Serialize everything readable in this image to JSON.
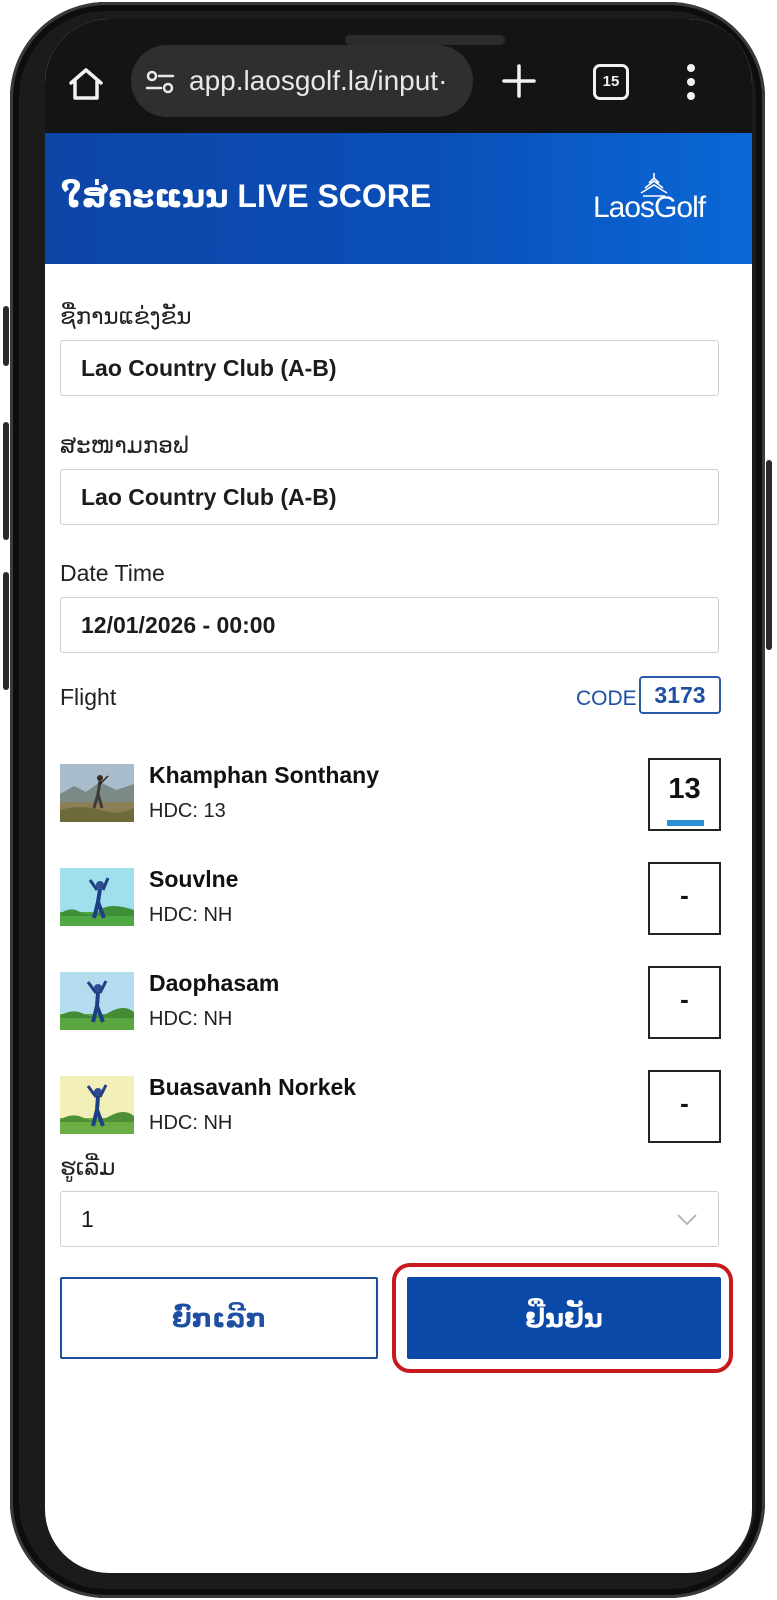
{
  "browser": {
    "url": "app.laosgolf.la/input·",
    "tab_count": "15"
  },
  "header": {
    "title": "ໃສ່ຄະແນນ LIVE SCORE",
    "logo_text": "LaosGolf"
  },
  "form": {
    "competition_label": "ຊື່ການແຂ່ງຂັນ",
    "competition_value": "Lao Country Club (A-B)",
    "course_label": "ສະໜາມກອຟ",
    "course_value": "Lao Country Club (A-B)",
    "datetime_label": "Date Time",
    "datetime_value": "12/01/2026 - 00:00",
    "flight_label": "Flight",
    "code_label": "CODE",
    "code_value": "3173",
    "start_hole_label": "ຮູເລີ່ມ",
    "start_hole_value": "1"
  },
  "players": [
    {
      "name": "Khamphan Sonthany",
      "hdc": "HDC: 13",
      "score": "13",
      "active": true
    },
    {
      "name": "Souvlne",
      "hdc": "HDC: NH",
      "score": "-",
      "active": false
    },
    {
      "name": "Daophasam",
      "hdc": "HDC: NH",
      "score": "-",
      "active": false
    },
    {
      "name": "Buasavanh Norkek",
      "hdc": "HDC: NH",
      "score": "-",
      "active": false
    }
  ],
  "buttons": {
    "cancel": "ຍົກເລີກ",
    "confirm": "ຢືນຢັນ"
  },
  "colors": {
    "brand_blue": "#0b49a9",
    "highlight_red": "#c8191f",
    "cursor_blue": "#2a91d6"
  }
}
